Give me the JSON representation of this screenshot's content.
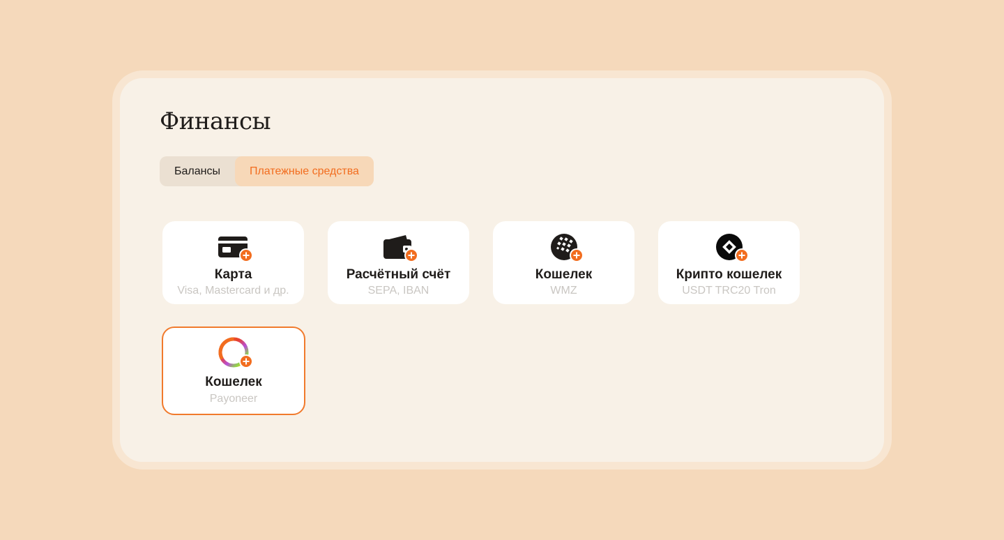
{
  "page": {
    "title": "Финансы"
  },
  "tabs": [
    {
      "label": "Балансы",
      "active": false
    },
    {
      "label": "Платежные средства",
      "active": true
    }
  ],
  "methods": [
    {
      "icon": "credit-card-add-icon",
      "title": "Карта",
      "subtitle": "Visa, Mastercard и др."
    },
    {
      "icon": "wallet-add-icon",
      "title": "Расчётный счёт",
      "subtitle": "SEPA, IBAN"
    },
    {
      "icon": "webmoney-add-icon",
      "title": "Кошелек",
      "subtitle": "WMZ"
    },
    {
      "icon": "crypto-add-icon",
      "title": "Крипто кошелек",
      "subtitle": "USDT TRC20 Tron"
    },
    {
      "icon": "payoneer-add-icon",
      "title": "Кошелек",
      "subtitle": "Payoneer",
      "selected": true
    }
  ],
  "colors": {
    "background": "#f5d9bb",
    "panel": "#f8f1e7",
    "accent": "#f26d1f",
    "tab_active_bg": "#f7d8b8",
    "subtitle_gray": "#c9c6c2"
  }
}
